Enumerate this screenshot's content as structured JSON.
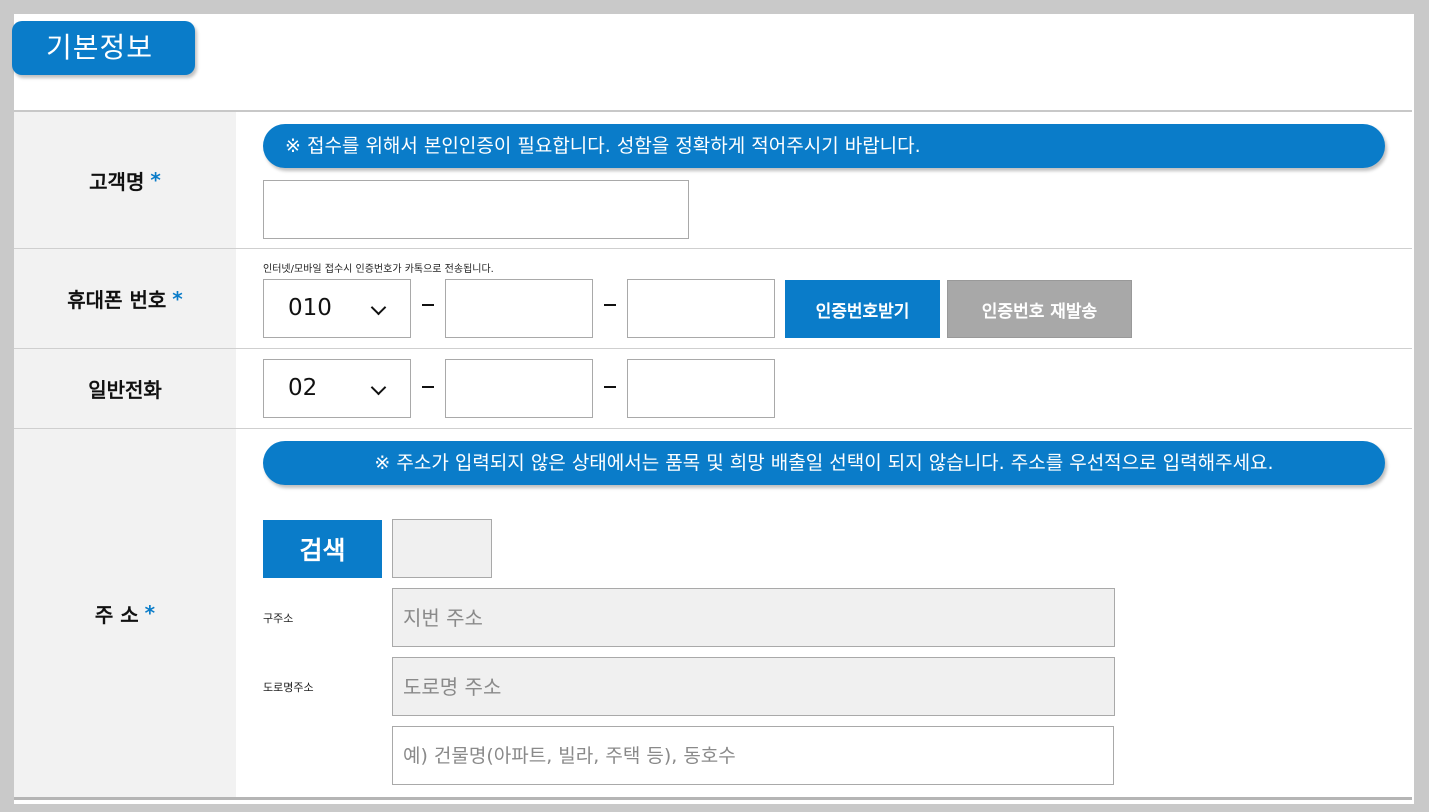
{
  "section": {
    "title": "기본정보"
  },
  "customer_name": {
    "label": "고객명",
    "required_mark": "*",
    "notice": "※ 접수를 위해서 본인인증이 필요합니다. 성함을 정확하게 적어주시기 바랍니다.",
    "value": ""
  },
  "mobile": {
    "label": "휴대폰 번호",
    "required_mark": "*",
    "note": "인터넷/모바일 접수시 인증번호가 카톡으로 전송됩니다.",
    "prefix_selected": "010",
    "middle": "",
    "last": "",
    "request_button": "인증번호받기",
    "resend_button": "인증번호 재발송"
  },
  "landline": {
    "label": "일반전화",
    "prefix_selected": "02",
    "middle": "",
    "last": ""
  },
  "address": {
    "label": "주 소",
    "required_mark": "*",
    "notice": "※ 주소가 입력되지 않은 상태에서는 품목 및 희망 배출일 선택이 되지 않습니다. 주소를 우선적으로 입력해주세요.",
    "search_button": "검색",
    "old_address_label": "구주소",
    "old_address_placeholder": "지번 주소",
    "road_address_label": "도로명주소",
    "road_address_placeholder": "도로명 주소",
    "detail_placeholder": "예) 건물명(아파트, 빌라, 주택 등), 동호수"
  },
  "colors": {
    "accent": "#0a7cc9",
    "disabled_button": "#a8a8a8",
    "label_bg": "#f2f2f2"
  }
}
